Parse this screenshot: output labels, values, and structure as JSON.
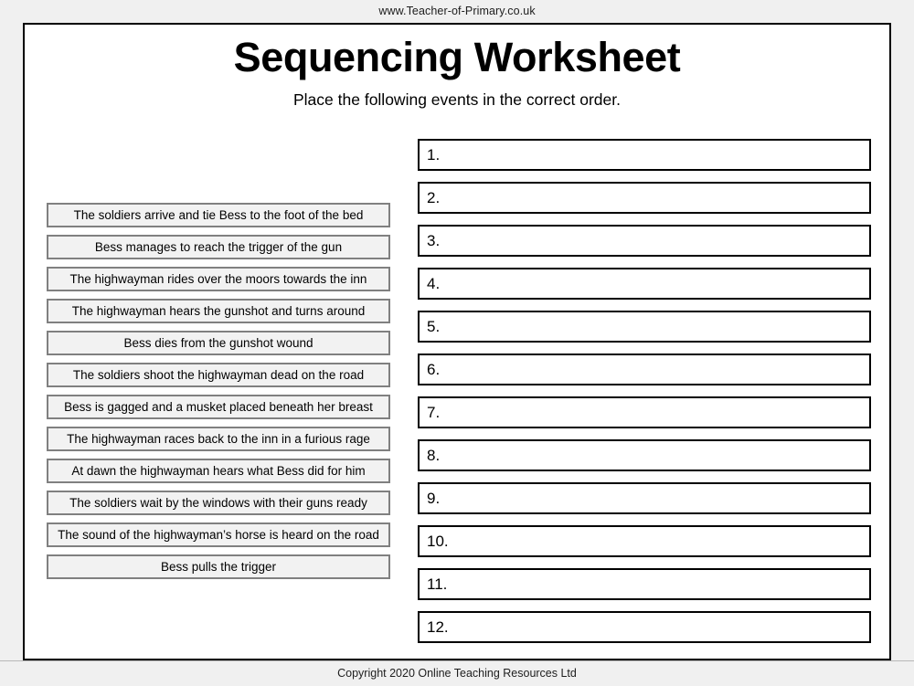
{
  "header": {
    "site_url": "www.Teacher-of-Primary.co.uk"
  },
  "worksheet": {
    "title": "Sequencing Worksheet",
    "instruction": "Place the following events in the correct order."
  },
  "events": [
    {
      "label": "The soldiers arrive and tie Bess to the foot of the bed"
    },
    {
      "label": "Bess manages to reach the trigger of the gun"
    },
    {
      "label": "The highwayman rides over the moors towards the inn"
    },
    {
      "label": "The highwayman hears the gunshot and turns around"
    },
    {
      "label": "Bess dies from the gunshot wound"
    },
    {
      "label": "The soldiers shoot the highwayman dead on the road"
    },
    {
      "label": "Bess is gagged and a musket placed beneath her breast"
    },
    {
      "label": "The highwayman races back to the inn in a furious rage"
    },
    {
      "label": "At dawn the highwayman hears what Bess did for him"
    },
    {
      "label": "The soldiers wait by the windows with their guns ready"
    },
    {
      "label": "The sound of the highwayman’s horse is heard on the road"
    },
    {
      "label": "Bess pulls the trigger"
    }
  ],
  "answers": [
    {
      "number": "1.",
      "value": ""
    },
    {
      "number": "2.",
      "value": ""
    },
    {
      "number": "3.",
      "value": ""
    },
    {
      "number": "4.",
      "value": ""
    },
    {
      "number": "5.",
      "value": ""
    },
    {
      "number": "6.",
      "value": ""
    },
    {
      "number": "7.",
      "value": ""
    },
    {
      "number": "8.",
      "value": ""
    },
    {
      "number": "9.",
      "value": ""
    },
    {
      "number": "10.",
      "value": ""
    },
    {
      "number": "11.",
      "value": ""
    },
    {
      "number": "12.",
      "value": ""
    }
  ],
  "footer": {
    "copyright": "Copyright 2020 Online Teaching Resources Ltd"
  },
  "colors": {
    "page_background": "#f0f0f0",
    "sheet_background": "#ffffff",
    "sheet_border": "#000000",
    "event_box_fill": "#f2f2f2",
    "event_box_border": "#808080",
    "answer_box_border": "#000000",
    "text": "#000000"
  }
}
